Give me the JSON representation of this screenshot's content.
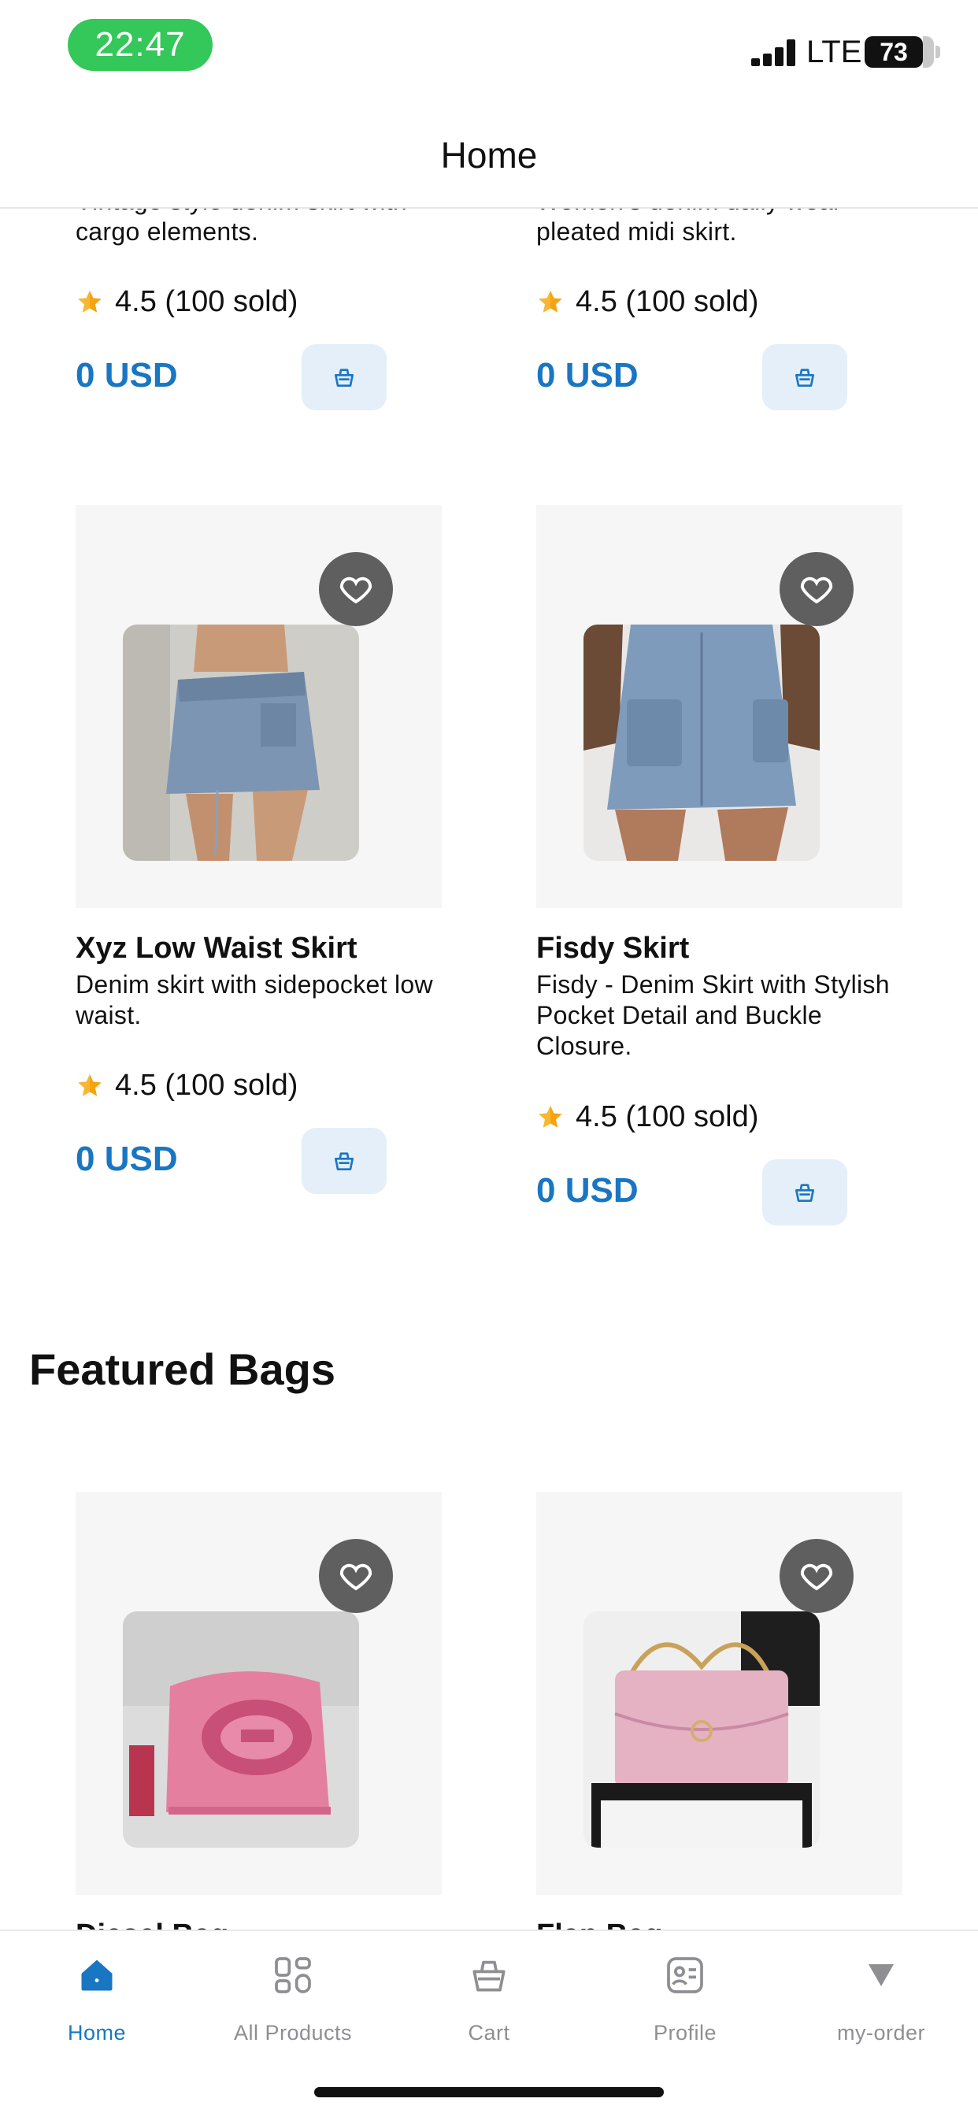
{
  "status_bar": {
    "time": "22:47",
    "network": "LTE",
    "battery": "73"
  },
  "header": {
    "title": "Home"
  },
  "partial_cards": [
    {
      "desc": "Vintage style denim skirt with cargo elements.",
      "rating": "4.5 (100 sold)",
      "price": "0 USD"
    },
    {
      "desc": "Women's denim daily wear pleated midi skirt.",
      "rating": "4.5 (100 sold)",
      "price": "0 USD"
    }
  ],
  "skirts": [
    {
      "name": "Xyz Low Waist Skirt",
      "desc": "Denim skirt with sidepocket low waist.",
      "rating": "4.5 (100 sold)",
      "price": "0 USD"
    },
    {
      "name": "Fisdy Skirt",
      "desc": "Fisdy - Denim Skirt with Stylish Pocket Detail and Buckle Closure.",
      "rating": "4.5 (100 sold)",
      "price": "0 USD"
    }
  ],
  "featured_bags": {
    "title": "Featured Bags",
    "items": [
      {
        "name": "Diesel Bag"
      },
      {
        "name": "Flap Bag"
      }
    ]
  },
  "bottom_nav": [
    {
      "label": "Home",
      "icon": "home-icon",
      "active": true
    },
    {
      "label": "All Products",
      "icon": "grid-icon",
      "active": false
    },
    {
      "label": "Cart",
      "icon": "basket-icon",
      "active": false
    },
    {
      "label": "Profile",
      "icon": "id-card-icon",
      "active": false
    },
    {
      "label": "my-order",
      "icon": "triangle-down-icon",
      "active": false
    }
  ],
  "colors": {
    "accent": "#1976c2",
    "cart_button_bg": "#e4eff9",
    "status_pill": "#34c759",
    "star": "#f5a30f",
    "favorite_button": "#5f5f5f"
  }
}
